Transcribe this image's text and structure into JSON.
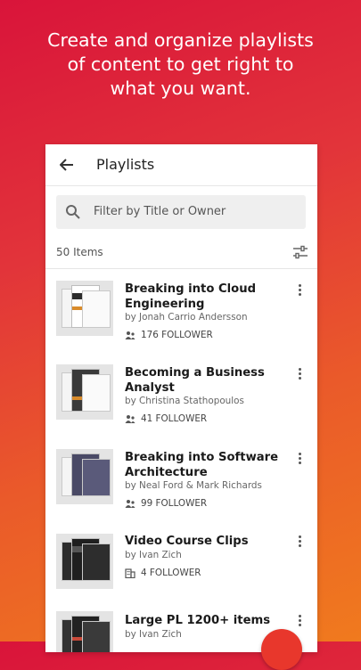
{
  "headline": {
    "line1": "Create and organize playlists",
    "line2": "of content to get right to",
    "line3": "what you want."
  },
  "appbar": {
    "title": "Playlists",
    "back_icon": "arrow-left-icon"
  },
  "search": {
    "placeholder": "Filter by Title or Owner",
    "icon": "search-icon"
  },
  "list_header": {
    "count_label": "50 Items",
    "filter_icon": "sliders-icon"
  },
  "playlists": [
    {
      "title_line1": "Breaking into Cloud",
      "title_line2": "Engineering",
      "author": "by Jonah Carrio Andersson",
      "followers": "176 FOLLOWER",
      "follower_icon": "people-icon"
    },
    {
      "title_line1": "Becoming a Business",
      "title_line2": "Analyst",
      "author": "by Christina Stathopoulos",
      "followers": "41 FOLLOWER",
      "follower_icon": "people-icon"
    },
    {
      "title_line1": "Breaking into Software",
      "title_line2": "Architecture",
      "author": "by Neal Ford & Mark Richards",
      "followers": "99 FOLLOWER",
      "follower_icon": "people-icon"
    },
    {
      "title_line1": "Video Course Clips",
      "title_line2": "",
      "author": "by Ivan Zich",
      "followers": "4 FOLLOWER",
      "follower_icon": "building-icon"
    },
    {
      "title_line1": "Large PL 1200+ items",
      "title_line2": "",
      "author": "by Ivan Zich",
      "followers": "",
      "follower_icon": ""
    }
  ],
  "colors": {
    "accent": "#e8372c",
    "gradient_top": "#d9143a",
    "gradient_bottom": "#f07a1e"
  }
}
